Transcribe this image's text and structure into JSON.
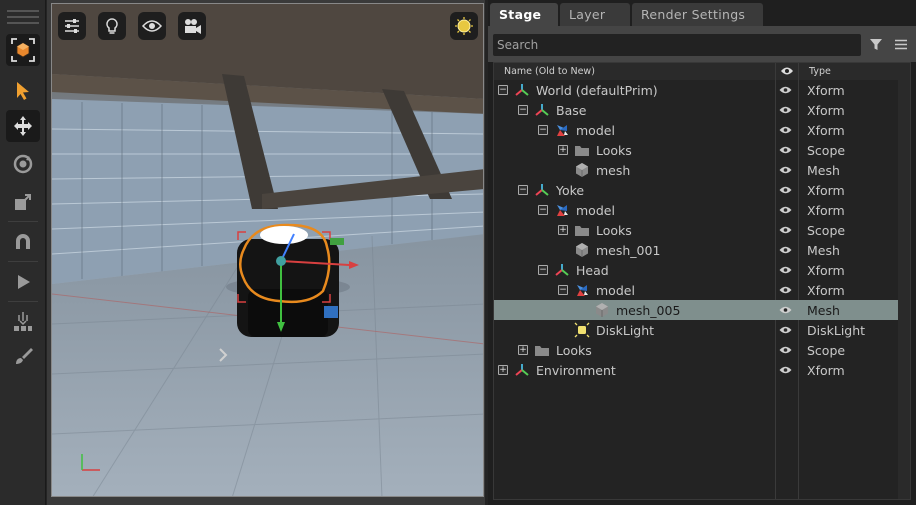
{
  "tabs": [
    {
      "label": "Stage"
    },
    {
      "label": "Layer"
    },
    {
      "label": "Render Settings"
    }
  ],
  "search": {
    "placeholder": "Search"
  },
  "columns": {
    "name": "Name (Old to New)",
    "type": "Type"
  },
  "tree": [
    {
      "label": "World (defaultPrim)",
      "type": "Xform",
      "icon": "xform-icon",
      "depth": 0,
      "expander": "−"
    },
    {
      "label": "Base",
      "type": "Xform",
      "icon": "xform-icon",
      "depth": 1,
      "expander": "−"
    },
    {
      "label": "model",
      "type": "Xform",
      "icon": "model-icon",
      "depth": 2,
      "expander": "−"
    },
    {
      "label": "Looks",
      "type": "Scope",
      "icon": "folder-icon",
      "depth": 3,
      "expander": "+"
    },
    {
      "label": "mesh",
      "type": "Mesh",
      "icon": "mesh-icon",
      "depth": 3,
      "expander": ""
    },
    {
      "label": "Yoke",
      "type": "Xform",
      "icon": "xform-icon",
      "depth": 1,
      "expander": "−"
    },
    {
      "label": "model",
      "type": "Xform",
      "icon": "model-icon",
      "depth": 2,
      "expander": "−"
    },
    {
      "label": "Looks",
      "type": "Scope",
      "icon": "folder-icon",
      "depth": 3,
      "expander": "+"
    },
    {
      "label": "mesh_001",
      "type": "Mesh",
      "icon": "mesh-icon",
      "depth": 3,
      "expander": ""
    },
    {
      "label": "Head",
      "type": "Xform",
      "icon": "xform-icon",
      "depth": 2,
      "expander": "−"
    },
    {
      "label": "model",
      "type": "Xform",
      "icon": "model-icon",
      "depth": 3,
      "expander": "−"
    },
    {
      "label": "mesh_005",
      "type": "Mesh",
      "icon": "mesh-icon",
      "depth": 4,
      "expander": "",
      "selected": true
    },
    {
      "label": "DiskLight",
      "type": "DiskLight",
      "icon": "light-icon",
      "depth": 3,
      "expander": ""
    },
    {
      "label": "Looks",
      "type": "Scope",
      "icon": "folder-icon",
      "depth": 1,
      "expander": "+"
    },
    {
      "label": "Environment",
      "type": "Xform",
      "icon": "xform-icon",
      "depth": 0,
      "expander": "+"
    }
  ],
  "colors": {
    "selection": "#7f8f8d",
    "accent": "#f0a030",
    "panel": "#1f1f1f"
  }
}
